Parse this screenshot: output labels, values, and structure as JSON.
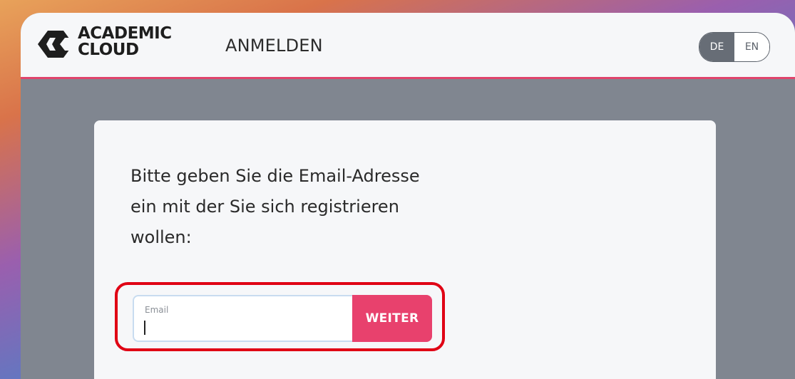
{
  "header": {
    "brand_line1": "ACADEMIC",
    "brand_line2": "CLOUD",
    "title": "ANMELDEN",
    "languages": [
      {
        "code": "DE",
        "active": true
      },
      {
        "code": "EN",
        "active": false
      }
    ]
  },
  "form": {
    "prompt": "Bitte geben Sie die Email-Adresse ein mit der Sie sich registrieren wollen:",
    "email_label": "Email",
    "email_value": "",
    "submit_label": "WEITER"
  },
  "colors": {
    "accent": "#e8416d",
    "header_border": "#e0446c",
    "backdrop": "#808690",
    "highlight": "#e00014"
  },
  "icons": {
    "logo": "academic-cloud-logo-icon"
  }
}
